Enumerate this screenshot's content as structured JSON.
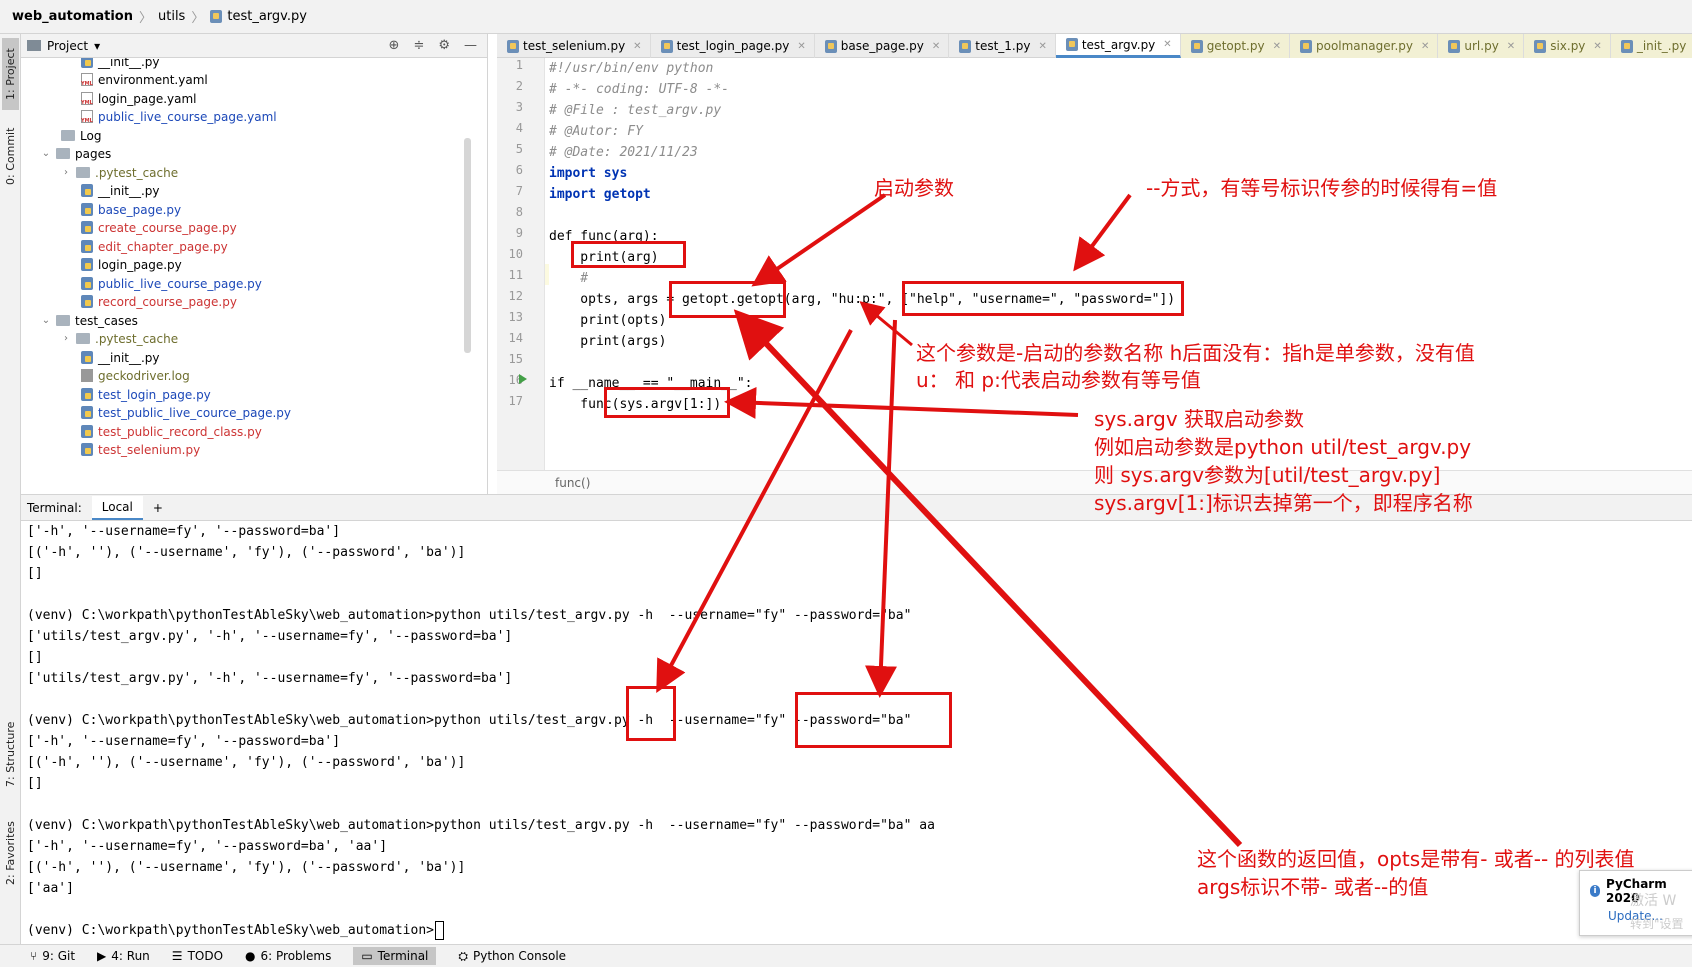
{
  "breadcrumb": {
    "root": "web_automation",
    "folder": "utils",
    "file": "test_argv.py"
  },
  "left_stripe": {
    "project_tab": "1: Project",
    "commit_tab": "0: Commit",
    "structure_tab": "7: Structure",
    "favorites_tab": "2: Favorites"
  },
  "project_panel": {
    "title": "Project",
    "tree": [
      {
        "label": "__init__.py",
        "kind": "py",
        "color": "black"
      },
      {
        "label": "environment.yaml",
        "kind": "yml",
        "color": "black"
      },
      {
        "label": "login_page.yaml",
        "kind": "yml",
        "color": "black"
      },
      {
        "label": "public_live_course_page.yaml",
        "kind": "yml",
        "color": "blue"
      },
      {
        "label": "Log",
        "kind": "folder",
        "color": "black"
      },
      {
        "label": "pages",
        "kind": "folder",
        "color": "black"
      },
      {
        "label": ".pytest_cache",
        "kind": "folder",
        "color": "olive"
      },
      {
        "label": "__init__.py",
        "kind": "py",
        "color": "black"
      },
      {
        "label": "base_page.py",
        "kind": "py",
        "color": "blue"
      },
      {
        "label": "create_course_page.py",
        "kind": "py",
        "color": "red"
      },
      {
        "label": "edit_chapter_page.py",
        "kind": "py",
        "color": "red"
      },
      {
        "label": "login_page.py",
        "kind": "py",
        "color": "black"
      },
      {
        "label": "public_live_course_page.py",
        "kind": "py",
        "color": "blue"
      },
      {
        "label": "record_course_page.py",
        "kind": "py",
        "color": "red"
      },
      {
        "label": "test_cases",
        "kind": "folder",
        "color": "black"
      },
      {
        "label": ".pytest_cache",
        "kind": "folder",
        "color": "olive"
      },
      {
        "label": "__init__.py",
        "kind": "py",
        "color": "black"
      },
      {
        "label": "geckodriver.log",
        "kind": "log",
        "color": "olive"
      },
      {
        "label": "test_login_page.py",
        "kind": "py",
        "color": "blue"
      },
      {
        "label": "test_public_live_cource_page.py",
        "kind": "py",
        "color": "blue"
      },
      {
        "label": "test_public_record_class.py",
        "kind": "py",
        "color": "red"
      },
      {
        "label": "test_selenium.py",
        "kind": "py",
        "color": "red"
      }
    ]
  },
  "editor_tabs": [
    {
      "label": "test_selenium.py",
      "active": false
    },
    {
      "label": "test_login_page.py",
      "active": false
    },
    {
      "label": "base_page.py",
      "active": false
    },
    {
      "label": "test_1.py",
      "active": false
    },
    {
      "label": "test_argv.py",
      "active": true
    },
    {
      "label": "getopt.py",
      "active": false
    },
    {
      "label": "poolmanager.py",
      "active": false
    },
    {
      "label": "url.py",
      "active": false
    },
    {
      "label": "six.py",
      "active": false
    },
    {
      "label": "_init_.py",
      "active": false
    }
  ],
  "code_lines": [
    "#!/usr/bin/env python",
    "# -*- coding: UTF-8 -*-",
    "# @File : test_argv.py",
    "# @Autor: FY",
    "# @Date: 2021/11/23",
    "import sys",
    "import getopt",
    "",
    "def func(arg):",
    "    print(arg)",
    "    #",
    "    opts, args = getopt.getopt(arg, \"hu:p:\", [\"help\", \"username=\", \"password=\"])",
    "    print(opts)",
    "    print(args)",
    "",
    "if __name__ == \"__main__\":",
    "    func(sys.argv[1:])"
  ],
  "status_crumb": "func()",
  "terminal": {
    "title": "Terminal:",
    "tab": "Local",
    "add": "+",
    "lines": [
      "['-h', '--username=fy', '--password=ba']",
      "[('-h', ''), ('--username', 'fy'), ('--password', 'ba')]",
      "[]",
      "",
      "(venv) C:\\workpath\\pythonTestAbleSky\\web_automation>python utils/test_argv.py -h  --username=\"fy\" --password=\"ba\"",
      "['utils/test_argv.py', '-h', '--username=fy', '--password=ba']",
      "[]",
      "['utils/test_argv.py', '-h', '--username=fy', '--password=ba']",
      "",
      "(venv) C:\\workpath\\pythonTestAbleSky\\web_automation>python utils/test_argv.py -h  --username=\"fy\" --password=\"ba\"",
      "['-h', '--username=fy', '--password=ba']",
      "[('-h', ''), ('--username', 'fy'), ('--password', 'ba')]",
      "[]",
      "",
      "(venv) C:\\workpath\\pythonTestAbleSky\\web_automation>python utils/test_argv.py -h  --username=\"fy\" --password=\"ba\" aa",
      "['-h', '--username=fy', '--password=ba', 'aa']",
      "[('-h', ''), ('--username', 'fy'), ('--password', 'ba')]",
      "['aa']",
      "",
      "(venv) C:\\workpath\\pythonTestAbleSky\\web_automation>"
    ]
  },
  "bottom_bar": {
    "git": "9: Git",
    "run": "4: Run",
    "todo": "TODO",
    "problems": "6: Problems",
    "terminal": "Terminal",
    "python_console": "Python Console"
  },
  "notification": {
    "title": "PyCharm 2020",
    "link": "Update...",
    "watermark1": "激活 W",
    "watermark2": "转到\"设置"
  },
  "annotations": {
    "startup_params": "启动参数",
    "double_dash": "--方式，有等号标识传参的时候得有=值",
    "param_names_1": "这个参数是-启动的参数名称 h后面没有：指h是单参数，没有值",
    "param_names_2": "u： 和 p:代表启动参数有等号值",
    "sys_argv_1": "sys.argv 获取启动参数",
    "sys_argv_2": "例如启动参数是python  util/test_argv.py",
    "sys_argv_3": "则 sys.argv参数为[util/test_argv.py]",
    "sys_argv_4": "sys.argv[1:]标识去掉第一个，即程序名称",
    "return_1": "这个函数的返回值，opts是带有- 或者-- 的列表值",
    "return_2": "args标识不带- 或者--的值"
  },
  "colors": {
    "annotation_red": "#e01010",
    "keyword_blue": "#0033b3",
    "string_green": "#067d17",
    "comment_gray": "#8c8c8c"
  }
}
